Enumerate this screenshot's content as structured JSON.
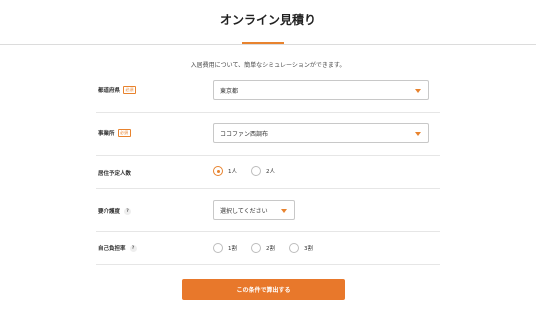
{
  "header": {
    "title": "オンライン見積り"
  },
  "intro": "入居費用について、簡単なシミュレーションができます。",
  "form": {
    "prefecture": {
      "label": "都道府県",
      "badge": "必須",
      "value": "東京都"
    },
    "facility": {
      "label": "事業所",
      "badge": "必須",
      "value": "ココファン西調布"
    },
    "occupants": {
      "label": "居住予定人数",
      "options": [
        "1人",
        "2人"
      ],
      "selected": "1人"
    },
    "care_level": {
      "label": "要介護度",
      "help": "?",
      "value": "選択してください"
    },
    "copay": {
      "label": "自己負担率",
      "help": "?",
      "options": [
        "1割",
        "2割",
        "3割"
      ]
    }
  },
  "submit_label": "この条件で算出する",
  "colors": {
    "accent": "#e8832e",
    "button": "#e8782b",
    "border": "#c8c8c8"
  }
}
